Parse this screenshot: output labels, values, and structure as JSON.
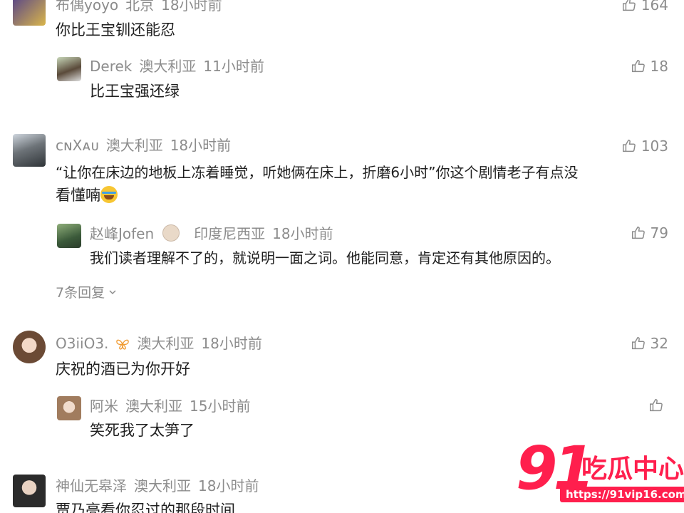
{
  "comments": [
    {
      "user": "布偶yoyo",
      "location": "北京",
      "time": "18小时前",
      "likes": "164",
      "content": "你比王宝钏还能忍",
      "replies": [
        {
          "user": "Derek",
          "location": "澳大利亚",
          "time": "11小时前",
          "likes": "18",
          "content": "比王宝强还绿"
        }
      ]
    },
    {
      "user": "cɴXᴀᴜ",
      "location": "澳大利亚",
      "time": "18小时前",
      "likes": "103",
      "content_line1": "“让你在床边的地板上冻着睡觉，听她俩在床上，折磨6小时”你这个剧情老子有点没",
      "content_line2": "看懂喃",
      "emoji": "laughing-tears-emoji",
      "replies": [
        {
          "user": "赵峰Jofen",
          "location": "印度尼西亚",
          "time": "18小时前",
          "likes": "79",
          "content": "我们读者理解不了的，就说明一面之词。他能同意，肯定还有其他原因的。"
        }
      ],
      "more_replies": "7条回复"
    },
    {
      "user": "O3iiO3.",
      "location": "澳大利亚",
      "time": "18小时前",
      "likes": "32",
      "content": "庆祝的酒已为你开好",
      "replies": [
        {
          "user": "阿米",
          "location": "澳大利亚",
          "time": "15小时前",
          "likes": "",
          "content": "笑死我了太笋了"
        }
      ]
    },
    {
      "user": "神仙无皋泽",
      "location": "澳大利亚",
      "time": "18小时前",
      "likes": "",
      "content": "贾乃亮看你忍过的那段时间"
    }
  ],
  "watermark": {
    "number": "91",
    "text": "吃瓜中心",
    "url": "https://91vip16.com"
  },
  "colors": {
    "meta": "#8c8c8c",
    "text": "#1f1f1f",
    "brand": "#ff1f4d"
  }
}
